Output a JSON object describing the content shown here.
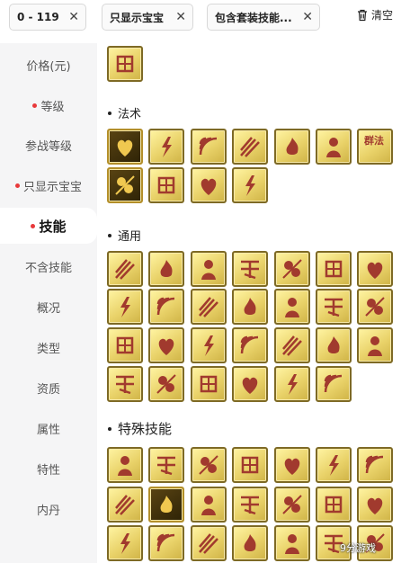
{
  "filters": {
    "chips": [
      {
        "label": "0 - 119",
        "close": "✕"
      },
      {
        "label": "只显示宝宝",
        "close": "✕"
      },
      {
        "label": "包含套装技能...",
        "close": "✕"
      }
    ],
    "clear_label": "清空"
  },
  "sidebar": {
    "items": [
      {
        "label": "价格(元)",
        "dot": false,
        "active": false
      },
      {
        "label": "等级",
        "dot": true,
        "active": false
      },
      {
        "label": "参战等级",
        "dot": false,
        "active": false
      },
      {
        "label": "只显示宝宝",
        "dot": true,
        "active": false
      },
      {
        "label": "技能",
        "dot": true,
        "active": true
      },
      {
        "label": "不含技能",
        "dot": false,
        "active": false
      },
      {
        "label": "概况",
        "dot": false,
        "active": false
      },
      {
        "label": "类型",
        "dot": false,
        "active": false
      },
      {
        "label": "资质",
        "dot": false,
        "active": false
      },
      {
        "label": "属性",
        "dot": false,
        "active": false
      },
      {
        "label": "特性",
        "dot": false,
        "active": false
      },
      {
        "label": "内丹",
        "dot": false,
        "active": false
      }
    ]
  },
  "sections": [
    {
      "title": "法术"
    },
    {
      "title": "通用"
    },
    {
      "title": "特殊技能"
    }
  ],
  "skill_icons": {
    "top": [
      "gate-glyph-icon"
    ],
    "fashu": [
      "heart-heal-icon",
      "lightning-strike-icon",
      "sonic-wave-icon",
      "triple-slash-icon",
      "fire-pillar-icon",
      "ghost-figure-icon",
      "群法",
      "meteor-icon",
      "flame-icon",
      "thunder-bolt-icon",
      "whirlwind-icon"
    ],
    "tongyong": [
      "charging-beast-icon",
      "wind-dash-icon",
      "half-shield-icon",
      "skull-swirl-icon",
      "owl-face-icon",
      "crossed-blades-icon",
      "return-arrow-icon",
      "arc-icon",
      "human-silhouette-icon",
      "mind-question-icon",
      "skeleton-icon",
      "wind-sweep-icon",
      "striped-shield-icon",
      "wings-icon",
      "crossed-swords-icon",
      "monster-face-icon",
      "sun-burst-icon",
      "sun-ring-icon",
      "sun-glow-icon",
      "sun-cross-icon",
      "door-figure-icon",
      "dragon-coil-icon",
      "slash-icon",
      "hooded-figure-icon",
      "hourglass-icon",
      "standing-figure-icon",
      "goblet-icon"
    ],
    "teshu": [
      "compass-icon",
      "dancer-icon",
      "nu-rune-icon",
      "spark-cross-icon",
      "sword-beam-icon",
      "spiral-slash-icon",
      "claw-icon",
      "arrow-burst-icon",
      "dark-rune-icon",
      "fist-burst-icon",
      "eye-sign-icon",
      "swirl-sun-icon",
      "meditation-icon",
      "tree-burst-icon",
      "sanskrit-icon",
      "vortex-icon",
      "lightning-shield-icon",
      "skull-trio-icon",
      "beast-head-icon",
      "tree-icon",
      "spiral-shell-icon"
    ]
  },
  "colors": {
    "tile_gold": "#e9d269",
    "tile_border": "#7e6a25",
    "glyph_red": "#a13a2e",
    "dot_red": "#e8393b"
  },
  "watermark": "9分游戏"
}
